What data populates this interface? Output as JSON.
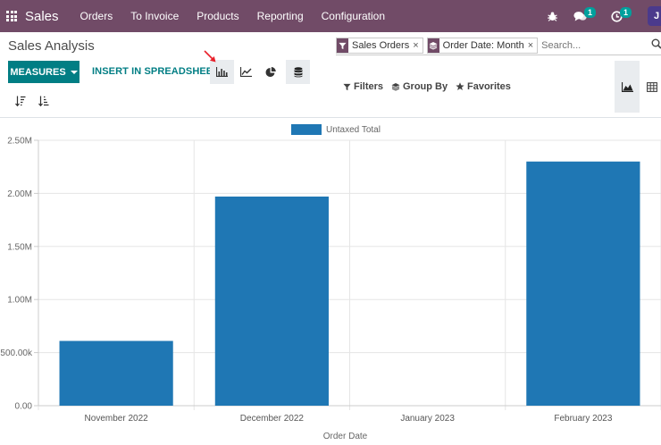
{
  "topbar": {
    "app_name": "Sales",
    "menu": [
      "Orders",
      "To Invoice",
      "Products",
      "Reporting",
      "Configuration"
    ],
    "chat_count": "1",
    "activity_count": "1",
    "avatar_letter": "J",
    "brand_color": "#714b67"
  },
  "page": {
    "title": "Sales Analysis"
  },
  "search": {
    "facets": [
      {
        "icon": "filter-icon",
        "label": "Sales Orders"
      },
      {
        "icon": "layers-icon",
        "label": "Order Date: Month"
      }
    ],
    "placeholder": "Search..."
  },
  "toolbar": {
    "measures_label": "MEASURES",
    "insert_label": "INSERT IN SPREADSHEET",
    "accent_color": "#017e84",
    "filters_label": "Filters",
    "groupby_label": "Group By",
    "favorites_label": "Favorites"
  },
  "chart_data": {
    "type": "bar",
    "categories": [
      "November 2022",
      "December 2022",
      "January 2023",
      "February 2023"
    ],
    "series": [
      {
        "name": "Untaxed Total",
        "color": "#1f77b4",
        "values": [
          610000,
          1970000,
          0,
          2300000
        ]
      }
    ],
    "xlabel": "Order Date",
    "ylabel": "",
    "ylim": [
      0,
      2500000
    ],
    "yticks": [
      0,
      500000,
      1000000,
      1500000,
      2000000,
      2500000
    ],
    "ytick_labels": [
      "0.00",
      "500.00k",
      "1.00M",
      "1.50M",
      "2.00M",
      "2.50M"
    ],
    "grid": true,
    "legend_position": "top"
  }
}
